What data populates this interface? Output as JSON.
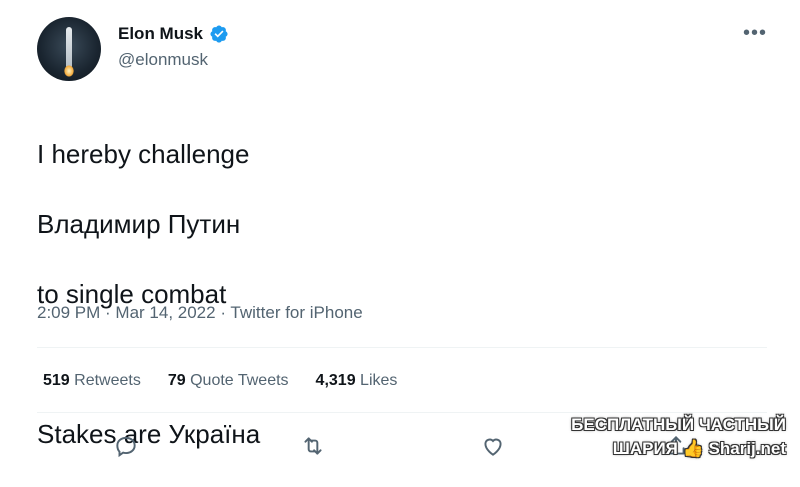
{
  "author": {
    "display_name": "Elon Musk",
    "handle": "@elonmusk",
    "verified_icon": "verified-badge-icon",
    "verified_color": "#1d9bf0"
  },
  "more_icon": "more-options-icon",
  "tweet": {
    "line1": "I hereby challenge",
    "line2": "Владимир Путин",
    "line3": "to single combat",
    "line4": "Stakes are Україна"
  },
  "meta": {
    "time": "2:09 PM",
    "sep1": " · ",
    "date": "Mar 14, 2022",
    "sep2": " · ",
    "source": "Twitter for iPhone"
  },
  "stats": {
    "retweets_count": "519",
    "retweets_label": "Retweets",
    "quotes_count": "79",
    "quotes_label": "Quote Tweets",
    "likes_count": "4,319",
    "likes_label": "Likes"
  },
  "actions": [
    "reply-icon",
    "retweet-icon",
    "like-icon",
    "share-icon"
  ],
  "watermark": {
    "line1": "БЕСПЛАТНЫЙ ЧАСТНЫЙ",
    "line2": "ШАРИЯ",
    "line3": "Sharij.net"
  },
  "colors": {
    "text": "#0f1419",
    "secondary": "#536471",
    "divider": "#eff3f4"
  }
}
